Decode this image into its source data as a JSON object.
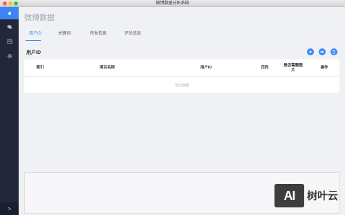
{
  "window": {
    "title": "微博数据分析系统"
  },
  "sidebar": {
    "items": [
      {
        "icon": "fire-icon",
        "active": true
      },
      {
        "icon": "chat-icon",
        "active": false
      },
      {
        "icon": "document-icon",
        "active": false
      },
      {
        "icon": "gear-icon",
        "active": false
      }
    ],
    "collapse_label": ">"
  },
  "page": {
    "title": "微博数据"
  },
  "tabs": [
    {
      "label": "用户ID",
      "active": true
    },
    {
      "label": "关键词",
      "active": false
    },
    {
      "label": "转发信息",
      "active": false
    },
    {
      "label": "评论信息",
      "active": false
    }
  ],
  "section": {
    "title": "用户ID"
  },
  "actions": [
    {
      "icon": "plus-icon"
    },
    {
      "icon": "eye-icon"
    },
    {
      "icon": "trash-icon"
    }
  ],
  "table": {
    "columns": [
      "索引",
      "项目名称",
      "用户ID",
      "页码",
      "是否需要图片",
      "操作"
    ],
    "empty_text": "暂无数据"
  },
  "watermark": {
    "logo": "AI",
    "text": "树叶云"
  },
  "colors": {
    "accent": "#3a86f5",
    "sidebar": "#22283a"
  }
}
